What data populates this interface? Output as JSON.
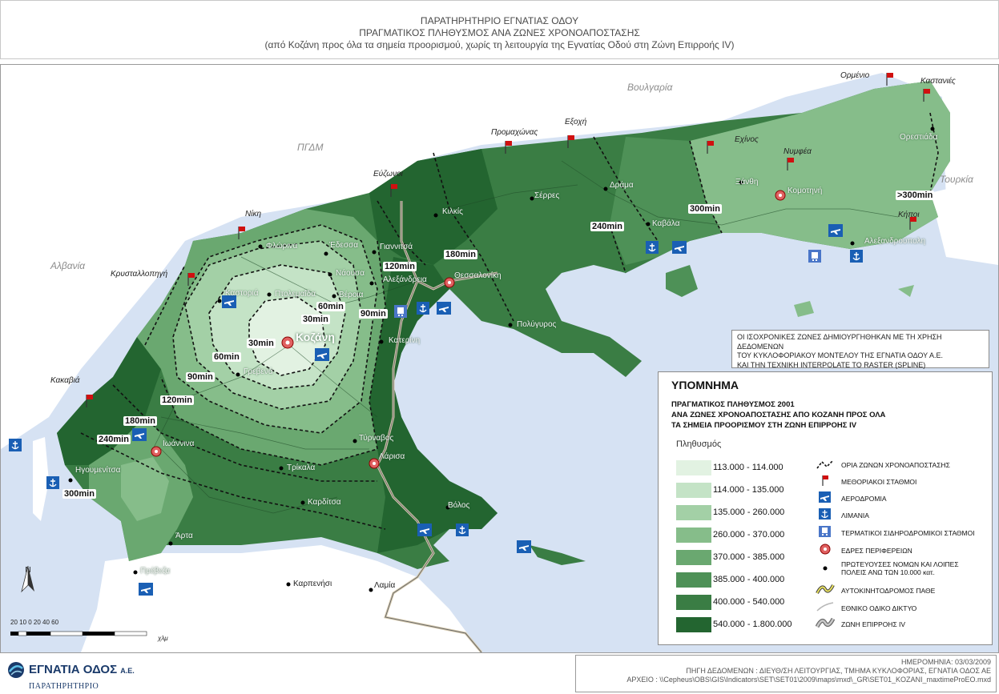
{
  "header": {
    "line1": "ΠΑΡΑΤΗΡΗΤΗΡΙΟ ΕΓΝΑΤΙΑΣ ΟΔΟΥ",
    "line2": "ΠΡΑΓΜΑΤΙΚΟΣ ΠΛΗΘΥΣΜΟΣ ΑΝΑ ΖΩΝΕΣ ΧΡΟΝΟΑΠΟΣΤΑΣΗΣ",
    "line3": "(από Κοζάνη προς όλα τα σημεία προορισμού, χωρίς τη  λειτουργία της Εγνατίας Οδού στη Ζώνη Επιρροής IV)"
  },
  "countries": {
    "bulgaria": "Βουλγαρία",
    "fyrom": "ΠΓΔΜ",
    "albania": "Αλβανία",
    "turkey": "Τουρκία"
  },
  "border_stations": {
    "ormenio": "Ορμένιο",
    "kastanies": "Καστανιές",
    "promachonas": "Προμαχώνας",
    "exochi": "Εξοχή",
    "echinos": "Εχίνος",
    "nymfea": "Νυμφέα",
    "evzonoi": "Εύζωνοι",
    "niki": "Νίκη",
    "krystallopigi": "Κρυσταλλοπηγή",
    "kipoi": "Κήποι",
    "kakavia": "Κακαβιά"
  },
  "cities": {
    "orestiada": "Ορεστιάδα",
    "xanthi": "Ξάνθη",
    "komotini": "Κομοτηνή",
    "drama": "Δράμα",
    "serres": "Σέρρες",
    "kilkis": "Κιλκίς",
    "kavala": "Καβάλα",
    "alexandroupoli": "Αλεξανδρούπολη",
    "florina": "Φλώρινα",
    "edessa": "Έδεσσα",
    "giannitsa": "Γιαννιτσά",
    "naousa": "Νάουσα",
    "alexandreia": "Αλεξάνδρεια",
    "thessaloniki": "Θεσσαλονίκη",
    "kastoria": "Καστοριά",
    "ptolemaida": "Πτολεμαΐδα",
    "veroia": "Βέροια",
    "polygyros": "Πολύγυρος",
    "kozani": "Κοζάνη",
    "katerini": "Κατερίνη",
    "grevena": "Γρεβενά",
    "ioannina": "Ιωάννινα",
    "igoumenitsa": "Ηγουμενίτσα",
    "tyrnavos": "Τύρναβος",
    "larisa": "Λάρισα",
    "trikala": "Τρίκαλα",
    "karditsa": "Καρδίτσα",
    "volos": "Βόλος",
    "arta": "Άρτα",
    "preveza": "Πρέβεζα",
    "karpenisi": "Καρπενήσι",
    "lamia": "Λαμία"
  },
  "zones": {
    "z30a": "30min",
    "z30b": "30min",
    "z60a": "60min",
    "z60b": "60min",
    "z90a": "90min",
    "z90b": "90min",
    "z120a": "120min",
    "z120b": "120min",
    "z180a": "180min",
    "z180b": "180min",
    "z240a": "240min",
    "z240b": "240min",
    "z300a": "300min",
    "z300b": "300min",
    "z300plus": ">300min"
  },
  "note": {
    "line1": "ΟΙ ΙΣΟΧΡΟΝΙΚΕΣ ΖΩΝΕΣ ΔΗΜΙΟΥΡΓΗΘΗΚΑΝ ΜΕ ΤΗ ΧΡΗΣΗ ΔΕΔΟΜΕΝΩΝ",
    "line2": "ΤΟΥ ΚΥΚΛΟΦΟΡΙΑΚΟΥ ΜΟΝΤΕΛΟΥ ΤΗΣ ΕΓΝΑΤΙΑ ΟΔΟΥ Α.Ε.",
    "line3": "ΚΑΙ ΤΗΝ ΤΕΧΝΙΚΗ INTERPOLATE TO RASTER (SPLINE)"
  },
  "legend": {
    "title": "ΥΠΟΜΝΗΜΑ",
    "sub1": "ΠΡΑΓΜΑΤΙΚΟΣ ΠΛΗΘΥΣΜΟΣ 2001",
    "sub2": "ΑΝΑ ΖΩΝΕΣ ΧΡΟΝΟΑΠΟΣΤΑΣΗΣ ΑΠΟ ΚΟΖΑΝΗ ΠΡΟΣ ΟΛΑ",
    "sub3": "ΤΑ ΣΗΜΕΙΑ ΠΡΟΟΡΙΣΜΟΥ ΣΤΗ ΖΩΝΗ ΕΠΙΡΡΟΗΣ IV",
    "population_heading": "Πληθυσμός",
    "classes": [
      {
        "label": "113.000 - 114.000",
        "color": "#e2f2e2"
      },
      {
        "label": "114.000 - 135.000",
        "color": "#c4e3c6"
      },
      {
        "label": "135.000 - 260.000",
        "color": "#a3d0a6"
      },
      {
        "label": "260.000 - 370.000",
        "color": "#86bd8a"
      },
      {
        "label": "370.000 - 385.000",
        "color": "#6aa870"
      },
      {
        "label": "385.000 - 400.000",
        "color": "#4e9157"
      },
      {
        "label": "400.000 - 540.000",
        "color": "#3a7d44"
      },
      {
        "label": "540.000 - 1.800.000",
        "color": "#236530"
      }
    ],
    "symbols": [
      {
        "label": "ΟΡΙΑ ΖΩΝΩΝ ΧΡΟΝΟΑΠΟΣΤΑΣΗΣ",
        "icon": "dashed-boundary-icon"
      },
      {
        "label": "ΜΕΘΟΡΙΑΚΟΙ ΣΤΑΘΜΟΙ",
        "icon": "red-flag-icon"
      },
      {
        "label": "ΑΕΡΟΔΡΟΜΙΑ",
        "icon": "airplane-icon"
      },
      {
        "label": "ΛΙΜΑΝΙΑ",
        "icon": "anchor-icon"
      },
      {
        "label": "ΤΕΡΜΑΤΙΚΟΙ ΣΙΔΗΡΟΔΡΟΜΙΚΟΙ ΣΤΑΘΜΟΙ",
        "icon": "train-icon"
      },
      {
        "label": "ΕΔΡΕΣ ΠΕΡΙΦΕΡΕΙΩΝ",
        "icon": "region-seat-icon"
      },
      {
        "label": "ΠΡΩΤΕΥΟΥΣΕΣ ΝΟΜΩΝ ΚΑΙ ΛΟΙΠΕΣ",
        "label2": "ΠΟΛΕΙΣ ΑΝΩ ΤΩΝ 10.000 κατ.",
        "icon": "city-dot-icon"
      },
      {
        "label": "ΑΥΤΟΚΙΝΗΤΟΔΡΟΜΟΣ ΠΑΘΕ",
        "icon": "motorway-icon"
      },
      {
        "label": "ΕΘΝΙΚΟ ΟΔΙΚΟ ΔΙΚΤΥΟ",
        "icon": "national-road-icon"
      },
      {
        "label": "ΖΩΝΗ ΕΠΙΡΡΟΗΣ IV",
        "icon": "influence-zone-icon"
      }
    ]
  },
  "scale": {
    "numbers": "20   10     0          20          40          60",
    "unit": "χλμ"
  },
  "north": "N",
  "footer": {
    "date": "ΗΜΕΡΟΜΗΝΙΑ: 03/03/2009",
    "source": "ΠΗΓΗ ΔΕΔΟΜΕΝΩΝ : ΔΙΕΥΘ/ΣΗ ΛΕΙΤΟΥΡΓΙΑΣ, ΤΜΗΜΑ ΚΥΚΛΟΦΟΡΙΑΣ, ΕΓΝΑΤΙΑ ΟΔΟΣ ΑΕ",
    "file": "ΑΡΧΕΙΟ : \\\\Cepheus\\OBS\\GIS\\Indicators\\SET\\SET01\\2009\\maps\\mxd\\_GR\\SET01_KOZANI_maxtimeProEO.mxd"
  },
  "logo": {
    "name": "ΕΓΝΑΤΙΑ ΟΔΟΣ",
    "suffix": "Α.Ε.",
    "subtitle": "ΠΑΡΑΤΗΡΗΤΗΡΙΟ"
  }
}
